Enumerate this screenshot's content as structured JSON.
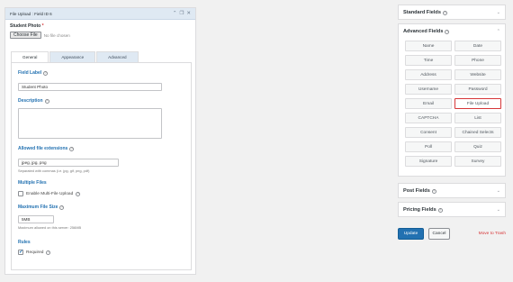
{
  "editor": {
    "title": "File Upload : Field ID 6",
    "preview_label": "Student Photo",
    "required_mark": "*",
    "choose_button": "Choose File",
    "no_file_text": "No file chosen",
    "tabs": [
      {
        "label": "General",
        "active": true
      },
      {
        "label": "Appearance",
        "active": false
      },
      {
        "label": "Advanced",
        "active": false
      }
    ],
    "field_label": {
      "label": "Field Label",
      "value": "Student Photo"
    },
    "description": {
      "label": "Description",
      "value": ""
    },
    "allowed_ext": {
      "label": "Allowed file extensions",
      "value": "jpeg, jpg, png",
      "help": "Separated with commas (i.e. jpg, gif, png, pdf)"
    },
    "multiple_files": {
      "label": "Multiple Files",
      "checkbox_label": "Enable Multi-File Upload",
      "checked": false
    },
    "max_size": {
      "label": "Maximum File Size",
      "value": "5MB",
      "help": "Maximum allowed on this server: 256MB"
    },
    "rules": {
      "label": "Rules",
      "checkbox_label": "Required",
      "checked": true
    }
  },
  "sidebar": {
    "standard": {
      "title": "Standard Fields"
    },
    "advanced": {
      "title": "Advanced Fields",
      "buttons": [
        "Name",
        "Date",
        "Time",
        "Phone",
        "Address",
        "Website",
        "Username",
        "Password",
        "Email",
        "File Upload",
        "CAPTCHA",
        "List",
        "Consent",
        "Chained Selects",
        "Poll",
        "Quiz",
        "Signature",
        "Survey"
      ],
      "highlighted": "File Upload"
    },
    "post": {
      "title": "Post Fields"
    },
    "pricing": {
      "title": "Pricing Fields"
    }
  },
  "actions": {
    "update": "Update",
    "cancel": "Cancel",
    "trash": "Move to Trash"
  },
  "colors": {
    "accent": "#2271b1",
    "danger": "#d63638",
    "header_bg": "#dfe9f3"
  }
}
